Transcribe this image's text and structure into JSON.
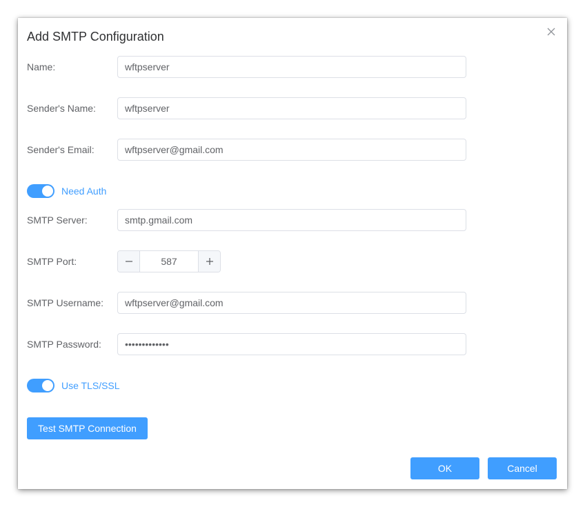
{
  "dialog": {
    "title": "Add SMTP Configuration",
    "close_icon": "close-icon"
  },
  "form": {
    "name": {
      "label": "Name:",
      "value": "wftpserver"
    },
    "sender_name": {
      "label": "Sender's Name:",
      "value": "wftpserver"
    },
    "sender_email": {
      "label": "Sender's Email:",
      "value": "wftpserver@gmail.com"
    },
    "need_auth": {
      "label": "Need Auth",
      "enabled": true
    },
    "smtp_server": {
      "label": "SMTP Server:",
      "value": "smtp.gmail.com"
    },
    "smtp_port": {
      "label": "SMTP Port:",
      "value": "587"
    },
    "smtp_username": {
      "label": "SMTP Username:",
      "value": "wftpserver@gmail.com"
    },
    "smtp_password": {
      "label": "SMTP Password:",
      "value": "•••••••••••••"
    },
    "use_tls": {
      "label": "Use TLS/SSL",
      "enabled": true
    }
  },
  "buttons": {
    "test_connection": "Test SMTP Connection",
    "ok": "OK",
    "cancel": "Cancel"
  },
  "colors": {
    "accent": "#409eff",
    "label_text": "#606266",
    "title_text": "#303133",
    "border": "#dcdfe6"
  }
}
